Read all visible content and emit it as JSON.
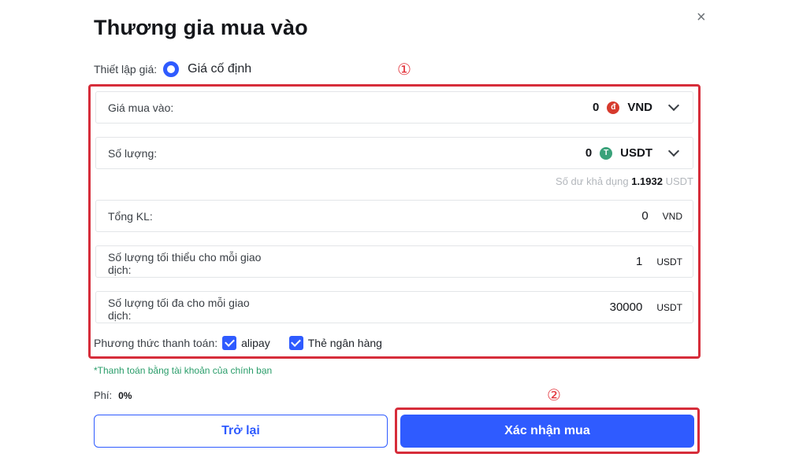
{
  "dialog": {
    "title": "Thương gia mua vào",
    "close_label": "×"
  },
  "price_setting": {
    "label": "Thiết lập giá:",
    "selected_option": "Giá cố định"
  },
  "annotations": {
    "marker_1": "①",
    "marker_2": "②"
  },
  "fields": {
    "buy_price": {
      "label": "Giá mua vào:",
      "value": "0",
      "currency": "VND",
      "coin_icon": "vnd-coin-icon",
      "coin_glyph": "đ"
    },
    "quantity": {
      "label": "Số lượng:",
      "value": "0",
      "currency": "USDT",
      "coin_icon": "usdt-coin-icon",
      "coin_glyph": "T"
    },
    "total": {
      "label": "Tổng KL:",
      "value": "0",
      "unit": "VND"
    },
    "min_per_trade": {
      "label_line1": "Số lượng tối thiểu cho mỗi giao",
      "label_line2": "dịch:",
      "value": "1",
      "unit": "USDT"
    },
    "max_per_trade": {
      "label_line1": "Số lượng tối đa cho mỗi giao",
      "label_line2": "dịch:",
      "value": "30000",
      "unit": "USDT"
    }
  },
  "balance": {
    "label": "Số dư khả dụng",
    "amount": "1.1932",
    "unit": "USDT"
  },
  "payment": {
    "label": "Phương thức thanh toán:",
    "options": [
      {
        "label": "alipay",
        "checked": true
      },
      {
        "label": "Thẻ ngân hàng",
        "checked": true
      }
    ]
  },
  "note": "*Thanh toán bằng tài khoản của chính bạn",
  "fee": {
    "label": "Phí:",
    "value": "0%"
  },
  "buttons": {
    "back": "Trở lại",
    "confirm": "Xác nhận mua"
  },
  "colors": {
    "accent": "#2f5bff",
    "annotation_red": "#d62d3a",
    "note_green": "#2a9d6a",
    "vnd_coin": "#d63a2d",
    "usdt_coin": "#3aa27a"
  }
}
